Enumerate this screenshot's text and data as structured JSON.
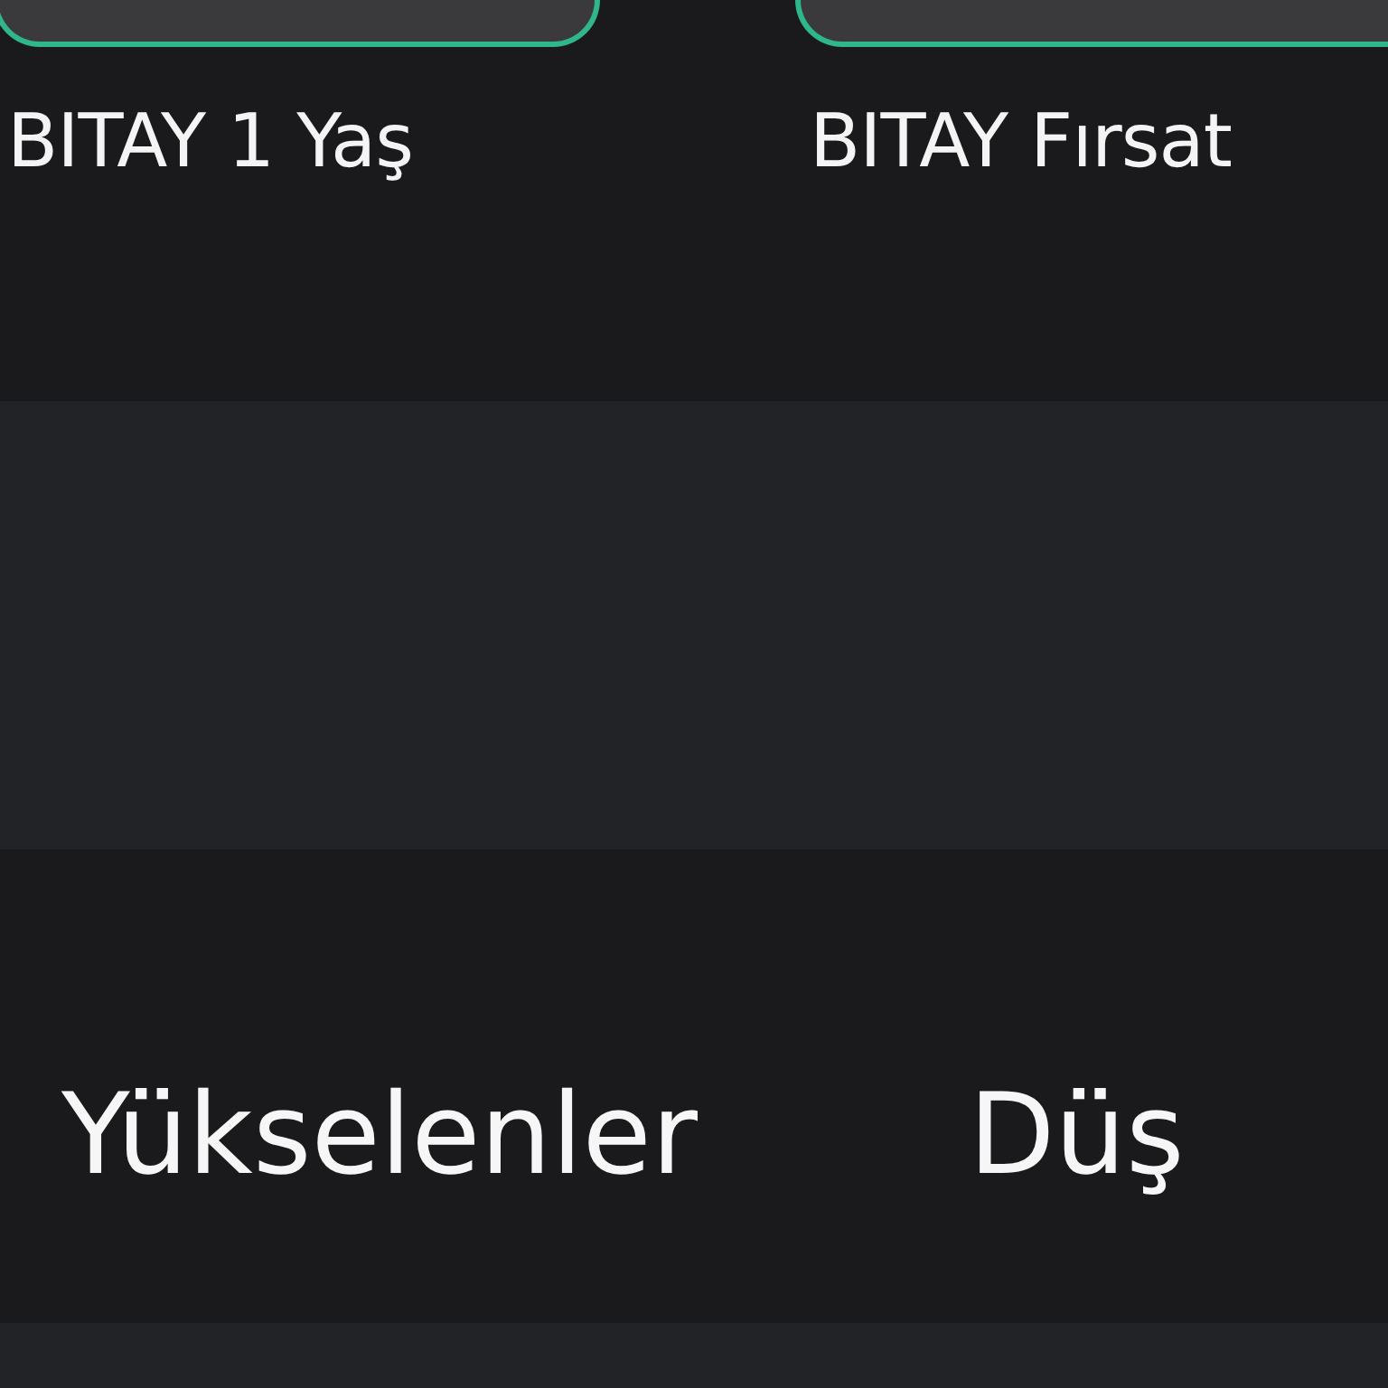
{
  "shortcuts": [
    {
      "label": "BITAY 1 Yaş"
    },
    {
      "label": "BITAY Fırsat"
    }
  ],
  "tabs": [
    {
      "label": "Yükselenler"
    },
    {
      "label": "Düş"
    }
  ]
}
